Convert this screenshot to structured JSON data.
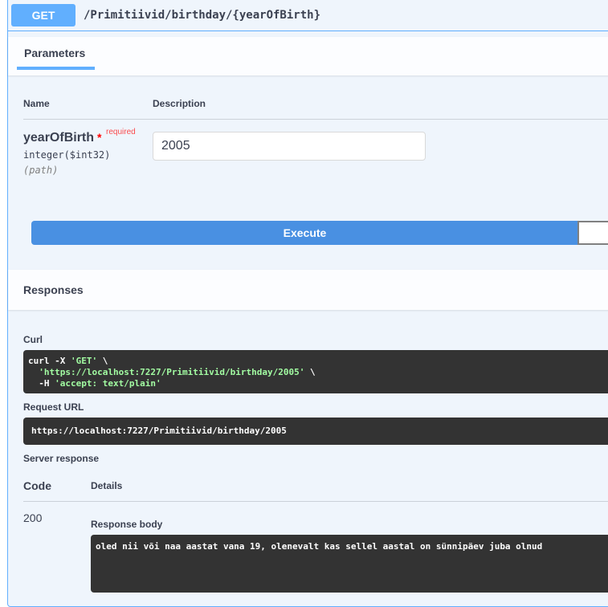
{
  "operation": {
    "method": "GET",
    "path": "/Primitiivid/birthday/{yearOfBirth}"
  },
  "parameters": {
    "tab_label": "Parameters",
    "col_name": "Name",
    "col_description": "Description",
    "param": {
      "name": "yearOfBirth",
      "required_star": "*",
      "required_label": "required",
      "type": "integer($int32)",
      "location": "(path)",
      "value": "2005"
    }
  },
  "execute_label": "Execute",
  "responses": {
    "title": "Responses",
    "curl_label": "Curl",
    "curl": {
      "l1_cmd": "curl -X ",
      "l1_str": "'GET'",
      "l1_end": " \\",
      "l2_pre": "  ",
      "l2_str": "'https://localhost:7227/Primitiivid/birthday/2005'",
      "l2_end": " \\",
      "l3_pre": "  -H ",
      "l3_str": "'accept: text/plain'"
    },
    "request_url_label": "Request URL",
    "request_url": "https://localhost:7227/Primitiivid/birthday/2005",
    "server_response_label": "Server response",
    "code_header": "Code",
    "details_header": "Details",
    "status_code": "200",
    "response_body_label": "Response body",
    "response_body": "oled nii või naa aastat vana 19, olenevalt kas sellel aastal on sünnipäev juba olnud"
  }
}
